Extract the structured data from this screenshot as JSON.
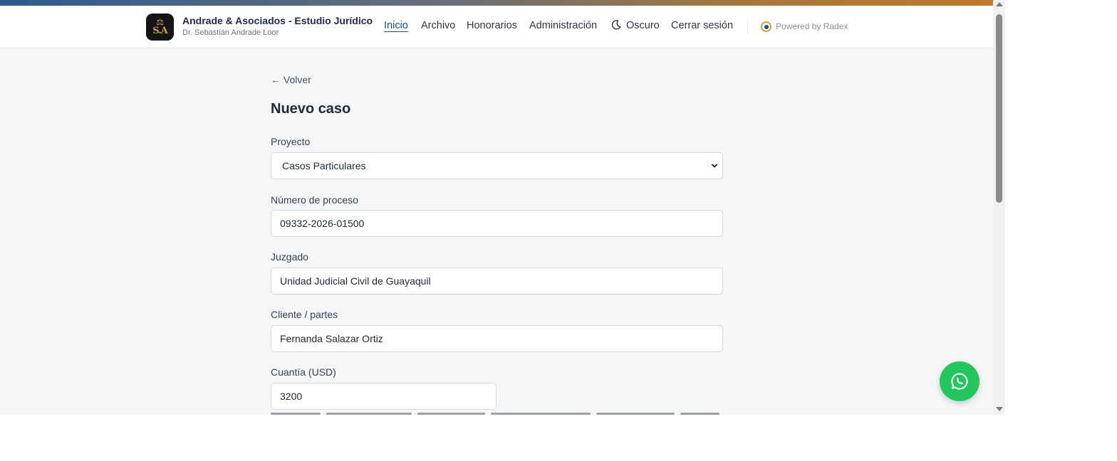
{
  "brand": {
    "logo_monogram": "S.A",
    "logo_symbol": "⚖",
    "firm_name": "Andrade & Asociados - Estudio Jurídico",
    "firm_subtitle": "Dr. Sebastián Andrade Loor"
  },
  "nav": {
    "items": [
      {
        "label": "Inicio",
        "active": true
      },
      {
        "label": "Archivo"
      },
      {
        "label": "Honorarios"
      },
      {
        "label": "Administración"
      }
    ],
    "theme_label": "Oscuro",
    "logout_label": "Cerrar sesión",
    "powered_label": "Powered by Radex"
  },
  "page": {
    "back_label": "← Volver",
    "title": "Nuevo caso"
  },
  "form": {
    "proyecto": {
      "label": "Proyecto",
      "value": "Casos Particulares"
    },
    "numero_proceso": {
      "label": "Número de proceso",
      "value": "09332-2026-01500"
    },
    "juzgado": {
      "label": "Juzgado",
      "value": "Unidad Judicial Civil de Guayaquil"
    },
    "cliente": {
      "label": "Cliente / partes",
      "value": "Fernanda Salazar Ortiz"
    },
    "cuantia": {
      "label": "Cuantía (USD)",
      "value": "3200"
    }
  },
  "colors": {
    "accent": "#1f4f82",
    "gold": "#c9a24b",
    "whatsapp": "#23c55e",
    "page_background": "#f5f6f7"
  },
  "icons": {
    "theme": "moon-icon",
    "whatsapp": "whatsapp-icon",
    "select": "chevron-down-icon",
    "radex": "radex-icon"
  }
}
